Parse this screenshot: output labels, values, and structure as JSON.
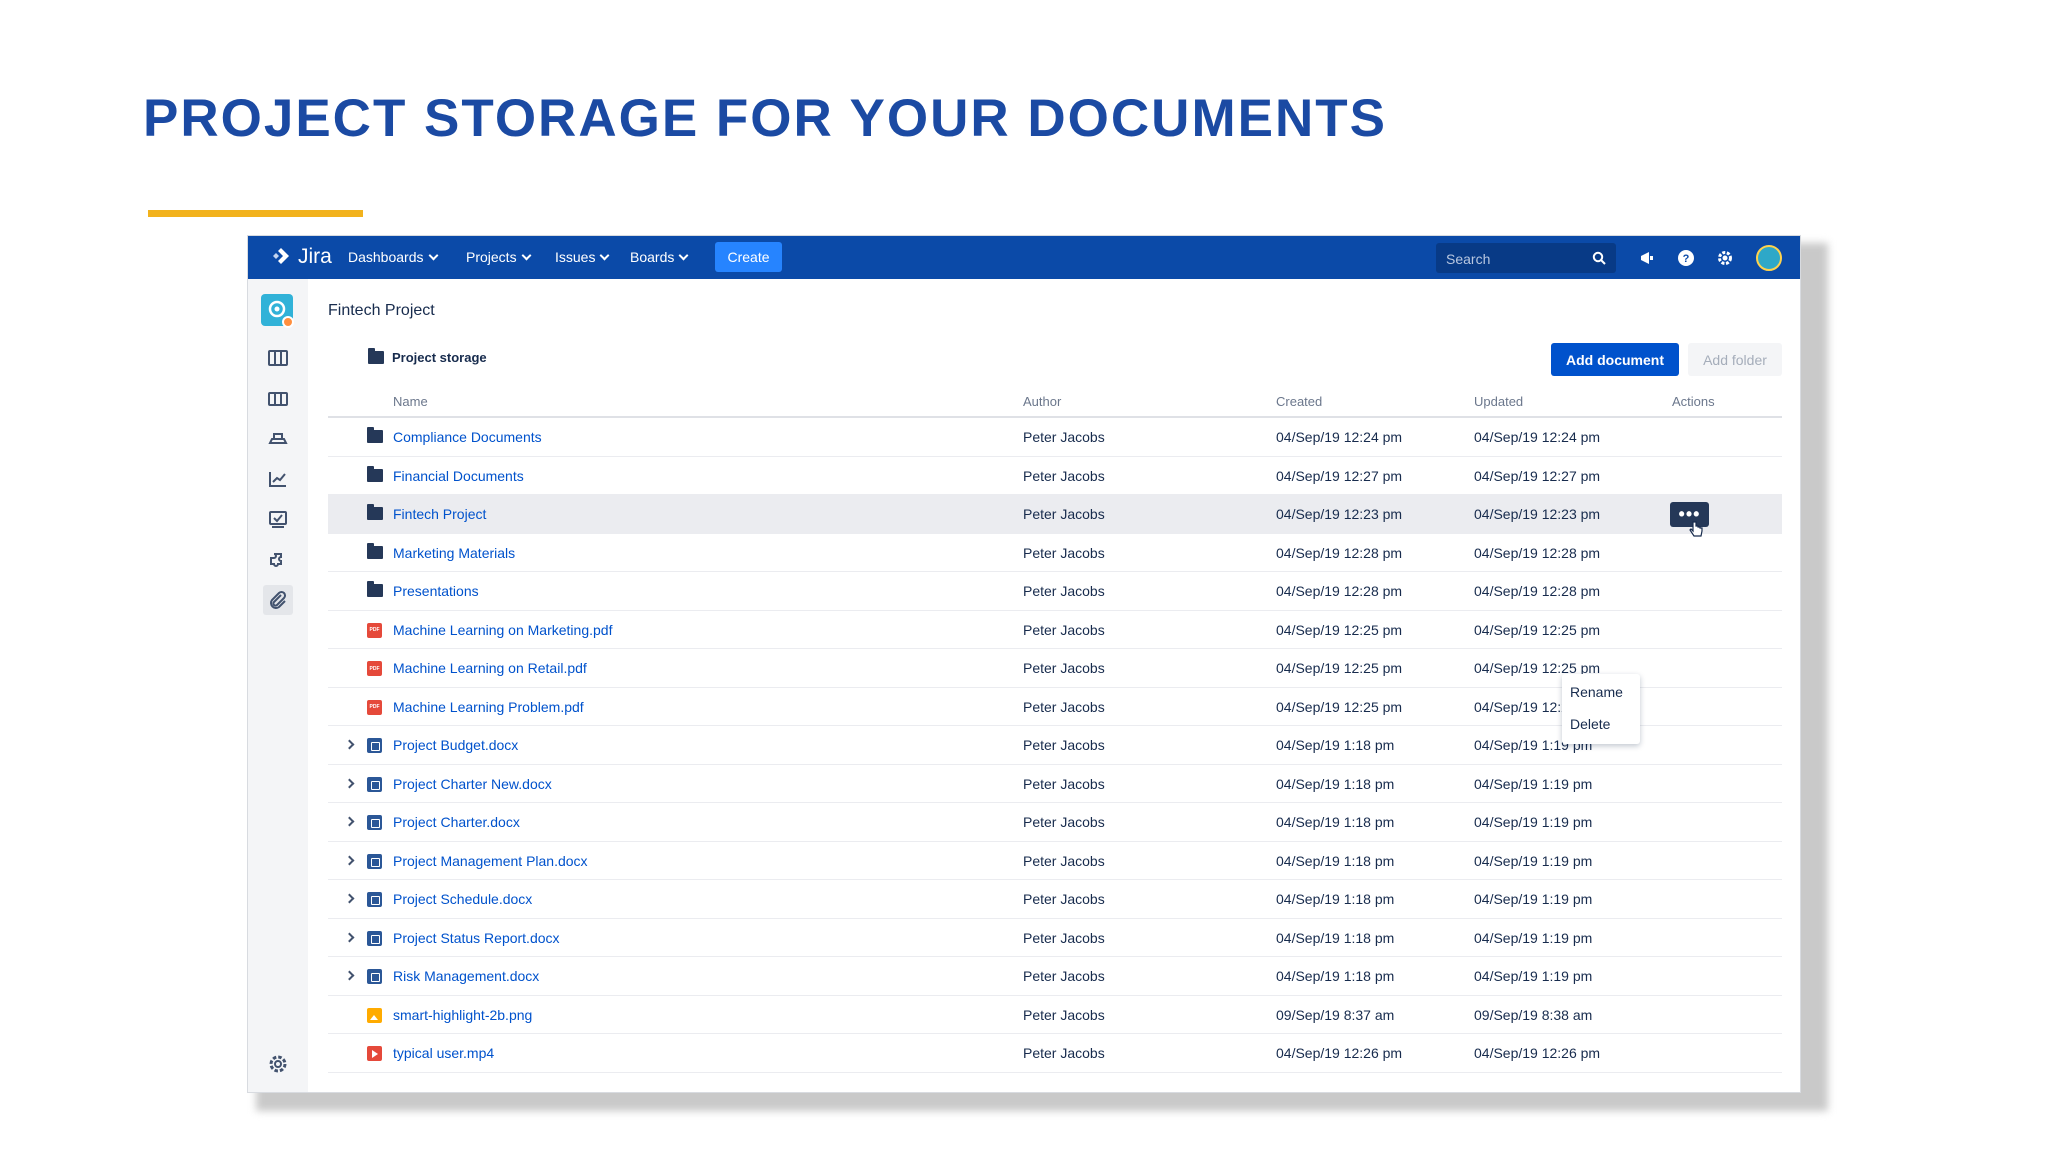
{
  "slide": {
    "title": "PROJECT STORAGE FOR YOUR DOCUMENTS",
    "accent_color": "#f2b21c",
    "title_color": "#1b4aa3"
  },
  "topnav": {
    "brand": "Jira",
    "items": [
      "Dashboards",
      "Projects",
      "Issues",
      "Boards"
    ],
    "create_label": "Create",
    "search_placeholder": "Search",
    "icons": [
      "notifications-icon",
      "help-icon",
      "settings-icon",
      "avatar"
    ],
    "bg_color": "#0b4aa8"
  },
  "sidebar": {
    "icons": [
      "project-avatar",
      "backlog-icon",
      "board-icon",
      "releases-icon",
      "reports-icon",
      "issues-icon",
      "components-icon",
      "attachments-icon"
    ],
    "bottom_icons": [
      "settings-icon",
      "expand-icon"
    ]
  },
  "main": {
    "project_title": "Fintech Project",
    "breadcrumb": "Project storage",
    "add_document_label": "Add document",
    "add_folder_label": "Add folder",
    "columns": [
      "Name",
      "Author",
      "Created",
      "Updated",
      "Actions"
    ],
    "rows": [
      {
        "type": "folder",
        "name": "Compliance Documents",
        "author": "Peter Jacobs",
        "created": "04/Sep/19 12:24 pm",
        "updated": "04/Sep/19 12:24 pm"
      },
      {
        "type": "folder",
        "name": "Financial Documents",
        "author": "Peter Jacobs",
        "created": "04/Sep/19 12:27 pm",
        "updated": "04/Sep/19 12:27 pm"
      },
      {
        "type": "folder",
        "name": "Fintech Project",
        "author": "Peter Jacobs",
        "created": "04/Sep/19 12:23 pm",
        "updated": "04/Sep/19 12:23 pm"
      },
      {
        "type": "folder",
        "name": "Marketing Materials",
        "author": "Peter Jacobs",
        "created": "04/Sep/19 12:28 pm",
        "updated": "04/Sep/19 12:28 pm"
      },
      {
        "type": "folder",
        "name": "Presentations",
        "author": "Peter Jacobs",
        "created": "04/Sep/19 12:28 pm",
        "updated": "04/Sep/19 12:28 pm"
      },
      {
        "type": "pdf",
        "name": "Machine Learning on Marketing.pdf",
        "author": "Peter Jacobs",
        "created": "04/Sep/19 12:25 pm",
        "updated": "04/Sep/19 12:25 pm"
      },
      {
        "type": "pdf",
        "name": "Machine Learning on Retail.pdf",
        "author": "Peter Jacobs",
        "created": "04/Sep/19 12:25 pm",
        "updated": "04/Sep/19 12:25 pm"
      },
      {
        "type": "pdf",
        "name": "Machine Learning Problem.pdf",
        "author": "Peter Jacobs",
        "created": "04/Sep/19 12:25 pm",
        "updated": "04/Sep/19 12:25 pm"
      },
      {
        "type": "doc",
        "name": "Project Budget.docx",
        "author": "Peter Jacobs",
        "created": "04/Sep/19 1:18 pm",
        "updated": "04/Sep/19 1:19 pm"
      },
      {
        "type": "doc",
        "name": "Project Charter New.docx",
        "author": "Peter Jacobs",
        "created": "04/Sep/19 1:18 pm",
        "updated": "04/Sep/19 1:19 pm"
      },
      {
        "type": "doc",
        "name": "Project Charter.docx",
        "author": "Peter Jacobs",
        "created": "04/Sep/19 1:18 pm",
        "updated": "04/Sep/19 1:19 pm"
      },
      {
        "type": "doc",
        "name": "Project Management Plan.docx",
        "author": "Peter Jacobs",
        "created": "04/Sep/19 1:18 pm",
        "updated": "04/Sep/19 1:19 pm"
      },
      {
        "type": "doc",
        "name": "Project Schedule.docx",
        "author": "Peter Jacobs",
        "created": "04/Sep/19 1:18 pm",
        "updated": "04/Sep/19 1:19 pm"
      },
      {
        "type": "doc",
        "name": "Project Status Report.docx",
        "author": "Peter Jacobs",
        "created": "04/Sep/19 1:18 pm",
        "updated": "04/Sep/19 1:19 pm"
      },
      {
        "type": "doc",
        "name": "Risk Management.docx",
        "author": "Peter Jacobs",
        "created": "04/Sep/19 1:18 pm",
        "updated": "04/Sep/19 1:19 pm"
      },
      {
        "type": "img",
        "name": "smart-highlight-2b.png",
        "author": "Peter Jacobs",
        "created": "09/Sep/19 8:37 am",
        "updated": "09/Sep/19 8:38 am"
      },
      {
        "type": "vid",
        "name": "typical user.mp4",
        "author": "Peter Jacobs",
        "created": "04/Sep/19 12:26 pm",
        "updated": "04/Sep/19 12:26 pm"
      }
    ],
    "actions_menu": {
      "more_label": "•••",
      "items": [
        "Rename",
        "Delete"
      ]
    }
  }
}
